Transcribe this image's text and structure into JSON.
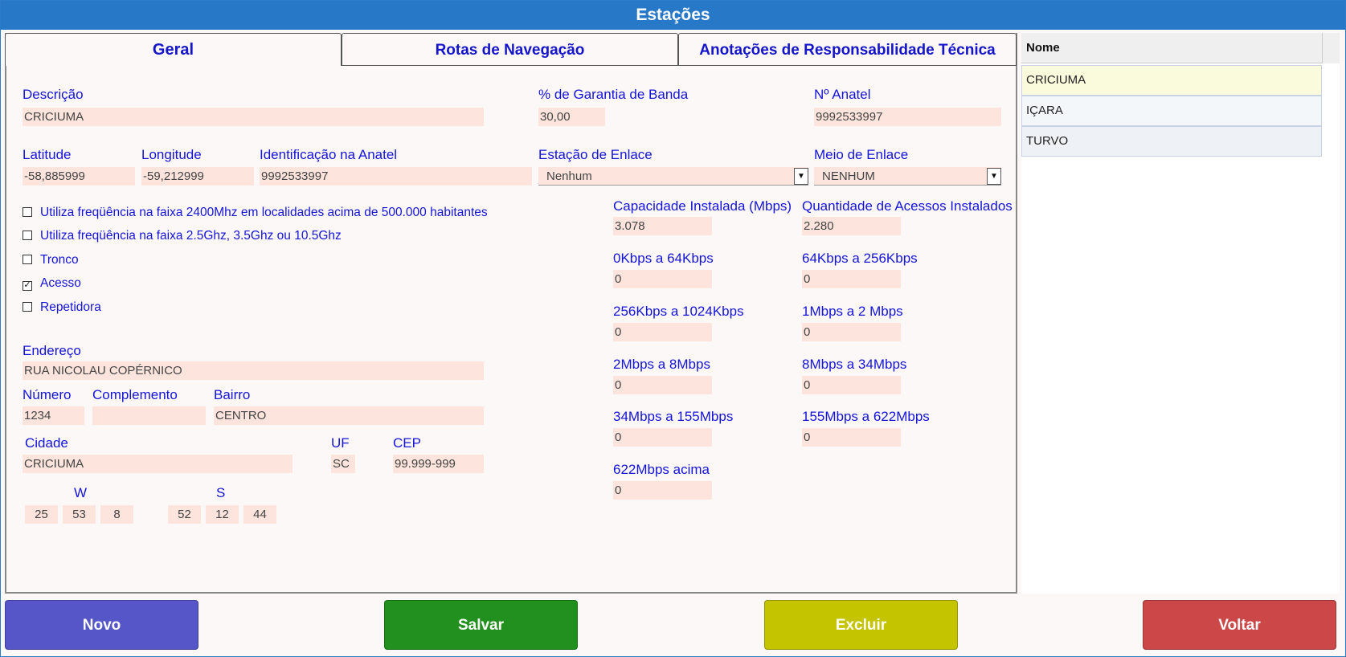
{
  "window": {
    "title": "Estações"
  },
  "tabs": [
    {
      "label": "Geral",
      "active": true
    },
    {
      "label": "Rotas de Navegação",
      "active": false
    },
    {
      "label": "Anotações de Responsabilidade Técnica",
      "active": false
    }
  ],
  "form": {
    "descricao": {
      "label": "Descrição",
      "value": "CRICIUMA"
    },
    "garantia": {
      "label": "% de Garantia de Banda",
      "value": "30,00"
    },
    "n_anatel": {
      "label": "Nº Anatel",
      "value": "9992533997"
    },
    "latitude": {
      "label": "Latitude",
      "value": "-58,885999"
    },
    "longitude": {
      "label": "Longitude",
      "value": "-59,212999"
    },
    "ident_anatel": {
      "label": "Identificação na Anatel",
      "value": "9992533997"
    },
    "estacao_enlace": {
      "label": "Estação de Enlace",
      "value": "Nenhum"
    },
    "meio_enlace": {
      "label": "Meio de Enlace",
      "value": "NENHUM"
    },
    "checkboxes": [
      {
        "label": "Utiliza freqüência na faixa 2400Mhz em localidades acima de 500.000 habitantes",
        "checked": false
      },
      {
        "label": "Utiliza freqüência na faixa 2.5Ghz, 3.5Ghz ou 10.5Ghz",
        "checked": false
      },
      {
        "label": "Tronco",
        "checked": false
      },
      {
        "label": "Acesso",
        "checked": true
      },
      {
        "label": "Repetidora",
        "checked": false
      }
    ],
    "endereco": {
      "label": "Endereço",
      "value": "RUA NICOLAU COPÉRNICO"
    },
    "numero": {
      "label": "Número",
      "value": "1234"
    },
    "complemento": {
      "label": "Complemento",
      "value": ""
    },
    "bairro": {
      "label": "Bairro",
      "value": "CENTRO"
    },
    "cidade": {
      "label": "Cidade",
      "value": "CRICIUMA"
    },
    "uf": {
      "label": "UF",
      "value": "SC"
    },
    "cep": {
      "label": "CEP",
      "value": "99.999-999"
    },
    "coord_w": {
      "label": "W",
      "values": [
        "25",
        "53",
        "8"
      ]
    },
    "coord_s": {
      "label": "S",
      "values": [
        "52",
        "12",
        "44"
      ]
    },
    "capacidade": {
      "label": "Capacidade Instalada (Mbps)",
      "value": "3.078"
    },
    "qtd_acessos": {
      "label": "Quantidade de Acessos Instalados",
      "value": "2.280"
    },
    "faixas": [
      {
        "label": "0Kbps a 64Kbps",
        "value": "0"
      },
      {
        "label": "64Kbps a 256Kbps",
        "value": "0"
      },
      {
        "label": "256Kbps a 1024Kbps",
        "value": "0"
      },
      {
        "label": "1Mbps a 2 Mbps",
        "value": "0"
      },
      {
        "label": "2Mbps a 8Mbps",
        "value": "0"
      },
      {
        "label": "8Mbps a 34Mbps",
        "value": "0"
      },
      {
        "label": "34Mbps a 155Mbps",
        "value": "0"
      },
      {
        "label": "155Mbps a 622Mbps",
        "value": "0"
      },
      {
        "label": "622Mbps acima",
        "value": "0"
      }
    ]
  },
  "grid": {
    "header": "Nome",
    "rows": [
      "CRICIUMA",
      "IÇARA",
      "TURVO"
    ]
  },
  "buttons": {
    "novo": "Novo",
    "salvar": "Salvar",
    "excluir": "Excluir",
    "voltar": "Voltar"
  },
  "colors": {
    "titlebar": "#2878c8",
    "field_bg": "#fde4dc",
    "label": "#1414d6",
    "novo": "#5656c8",
    "salvar": "#22901e",
    "excluir": "#c4c400",
    "voltar": "#cc4848",
    "row_selected": "#fafadc"
  }
}
